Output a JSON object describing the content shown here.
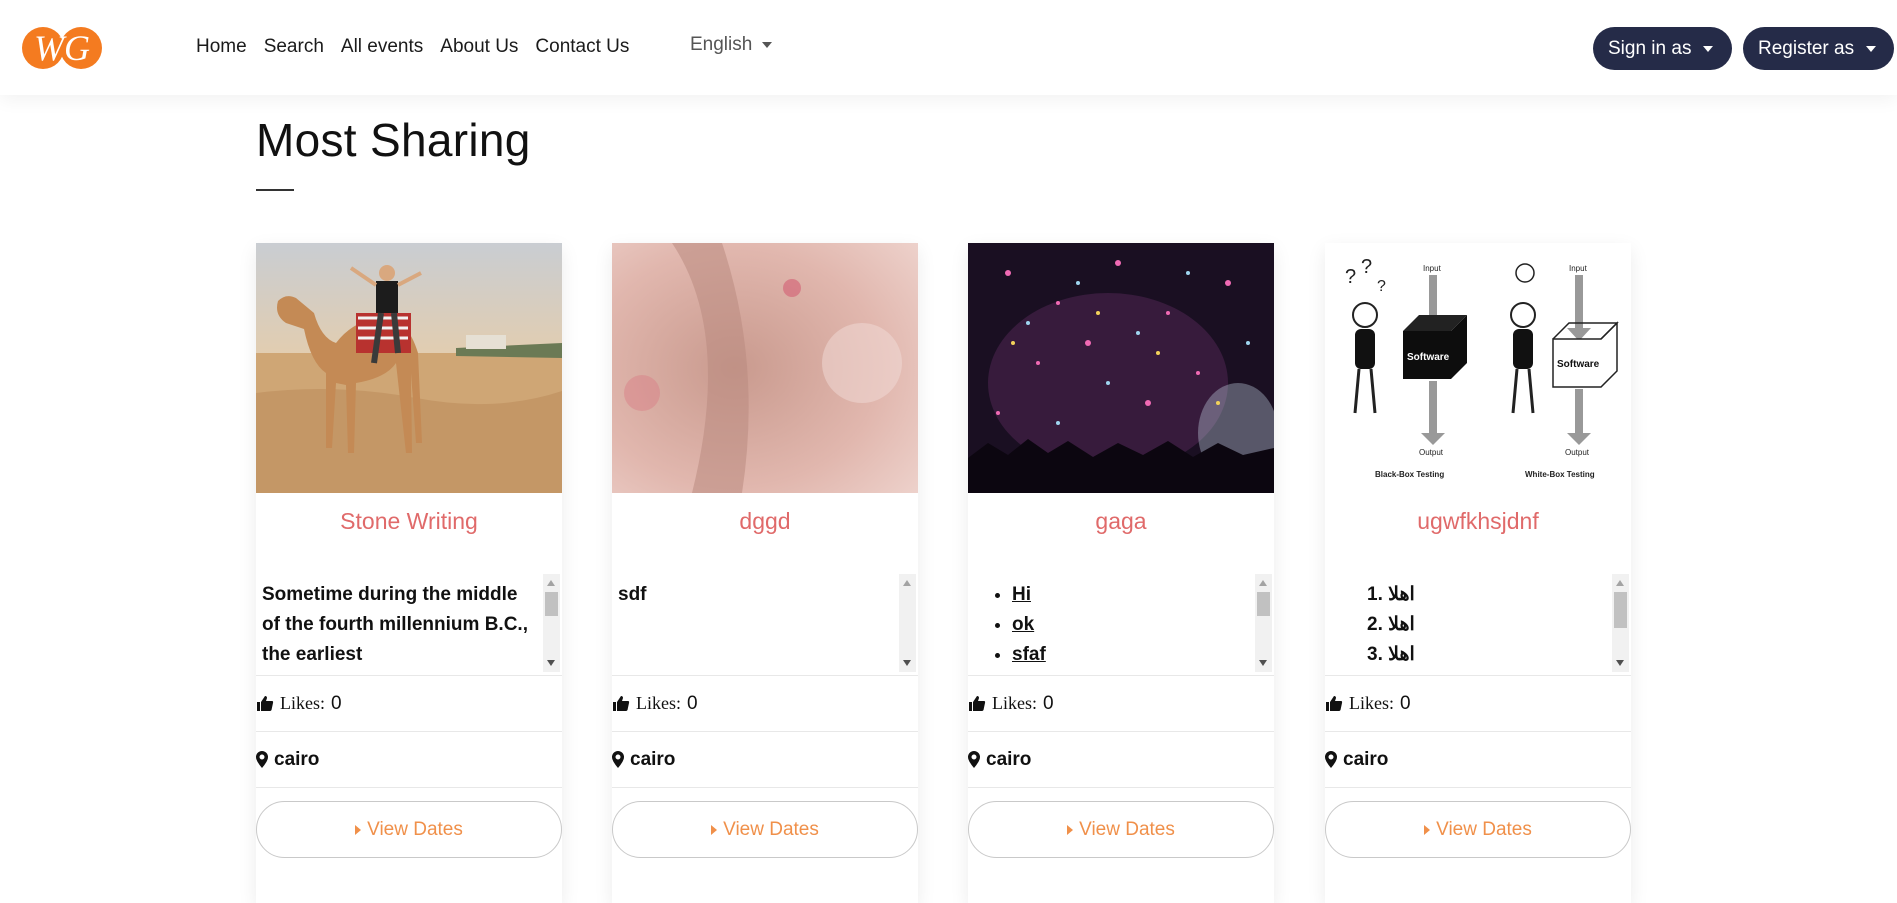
{
  "nav": {
    "links": [
      "Home",
      "Search",
      "All events",
      "About Us",
      "Contact Us"
    ],
    "language": "English",
    "signin_label": "Sign in as",
    "register_label": "Register as"
  },
  "brand": {
    "logo_text": "WG",
    "logo_color": "#f47b20",
    "primary_dark": "#252b48",
    "title_color": "#e06a6a",
    "button_text_color": "#f0904a"
  },
  "section": {
    "title": "Most Sharing"
  },
  "cards": [
    {
      "title": "Stone Writing",
      "image": "camel-rider-photo",
      "description": "Sometime during the middle of the fourth millennium B.C., the earliest",
      "likes_label": "Likes:",
      "likes": "0",
      "location": "cairo",
      "button_label": "View Dates"
    },
    {
      "title": "dggd",
      "image": "skin-texture-photo",
      "description": "sdf",
      "likes_label": "Likes:",
      "likes": "0",
      "location": "cairo",
      "button_label": "View Dates"
    },
    {
      "title": "gaga",
      "image": "confetti-concert-photo",
      "list": [
        "Hi",
        "ok",
        "sfaf"
      ],
      "likes_label": "Likes:",
      "likes": "0",
      "location": "cairo",
      "button_label": "View Dates"
    },
    {
      "title": "ugwfkhsjdnf",
      "image": "black-white-box-testing-diagram",
      "diagram": {
        "box_label": "Software",
        "input_label": "Input",
        "output_label": "Output",
        "left_caption": "Black-Box Testing",
        "right_caption": "White-Box Testing"
      },
      "ordered": [
        "1. اهلا",
        "2. اهلا",
        "3. اهلا"
      ],
      "likes_label": "Likes:",
      "likes": "0",
      "location": "cairo",
      "button_label": "View Dates"
    }
  ]
}
